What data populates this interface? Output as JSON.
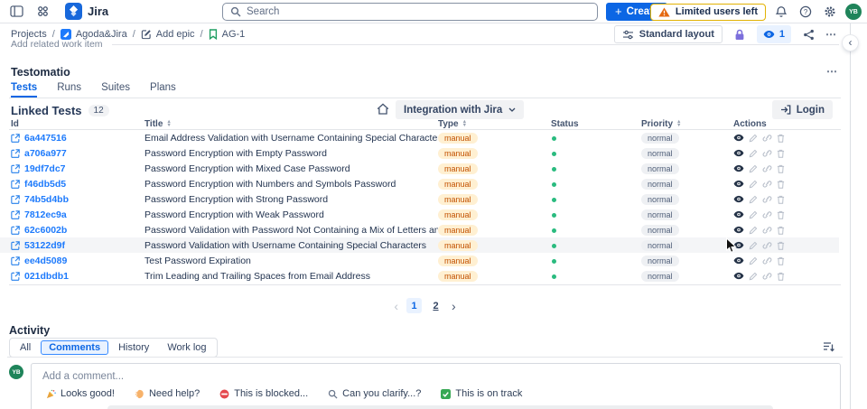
{
  "topbar": {
    "app_name": "Jira",
    "search": {
      "placeholder": "Search"
    },
    "create_button": "Create",
    "warning_badge": "Limited users left",
    "avatar_initials": "YB"
  },
  "breadcrumb": {
    "items": [
      "Projects",
      "Agoda&Jira",
      "Add epic",
      "AG-1"
    ],
    "separator": "/"
  },
  "page_toolbar": {
    "standard_layout_label": "Standard layout",
    "watchers_count": "1",
    "more_label": "⋯"
  },
  "content": {
    "add_related_work_item": "Add related work item",
    "panel_title": "Testomatio",
    "panel_more_label": "⋯",
    "panel_tabs": [
      {
        "label": "Tests",
        "active": true
      },
      {
        "label": "Runs",
        "active": false
      },
      {
        "label": "Suites",
        "active": false
      },
      {
        "label": "Plans",
        "active": false
      }
    ]
  },
  "linked_tests": {
    "title": "Linked Tests",
    "count": "12",
    "integration_dropdown": "Integration with Jira",
    "login_button": "Login",
    "columns": [
      {
        "label": "Id",
        "sortable": false
      },
      {
        "label": "Title",
        "sortable": true
      },
      {
        "label": "Type",
        "sortable": true
      },
      {
        "label": "Status",
        "sortable": false
      },
      {
        "label": "Priority",
        "sortable": true
      },
      {
        "label": "Actions",
        "sortable": false
      }
    ],
    "row_actions": [
      "view-icon",
      "edit-icon",
      "unlink-icon",
      "delete-icon"
    ],
    "rows": [
      {
        "id": "6a447516",
        "title": "Email Address Validation with Username Containing Special Characters",
        "type": "manual",
        "status_dot": "green",
        "priority": "normal",
        "highlighted": false
      },
      {
        "id": "a706a977",
        "title": "Password Encryption with Empty Password",
        "type": "manual",
        "status_dot": "green",
        "priority": "normal",
        "highlighted": false
      },
      {
        "id": "19df7dc7",
        "title": "Password Encryption with Mixed Case Password",
        "type": "manual",
        "status_dot": "green",
        "priority": "normal",
        "highlighted": false
      },
      {
        "id": "f46db5d5",
        "title": "Password Encryption with Numbers and Symbols Password",
        "type": "manual",
        "status_dot": "green",
        "priority": "normal",
        "highlighted": false
      },
      {
        "id": "74b5d4bb",
        "title": "Password Encryption with Strong Password",
        "type": "manual",
        "status_dot": "green",
        "priority": "normal",
        "highlighted": false
      },
      {
        "id": "7812ec9a",
        "title": "Password Encryption with Weak Password",
        "type": "manual",
        "status_dot": "green",
        "priority": "normal",
        "highlighted": false
      },
      {
        "id": "62c6002b",
        "title": "Password Validation with Password Not Containing a Mix of Letters and Numbers",
        "type": "manual",
        "status_dot": "green",
        "priority": "normal",
        "highlighted": false
      },
      {
        "id": "53122d9f",
        "title": "Password Validation with Username Containing Special Characters",
        "type": "manual",
        "status_dot": "green",
        "priority": "normal",
        "highlighted": true
      },
      {
        "id": "ee4d5089",
        "title": "Test Password Expiration",
        "type": "manual",
        "status_dot": "green",
        "priority": "normal",
        "highlighted": false
      },
      {
        "id": "021dbdb1",
        "title": "Trim Leading and Trailing Spaces from Email Address",
        "type": "manual",
        "status_dot": "green",
        "priority": "normal",
        "highlighted": false
      }
    ],
    "pagination": {
      "prev": "‹",
      "pages": [
        "1",
        "2"
      ],
      "current": "1",
      "next": "›"
    }
  },
  "activity": {
    "title": "Activity",
    "filter_tabs": [
      {
        "label": "All",
        "active": false
      },
      {
        "label": "Comments",
        "active": true
      },
      {
        "label": "History",
        "active": false
      },
      {
        "label": "Work log",
        "active": false
      }
    ]
  },
  "comment": {
    "avatar_initials": "YB",
    "placeholder": "Add a comment...",
    "quick_replies": [
      {
        "icon": "party-popper-icon",
        "label": "Looks good!"
      },
      {
        "icon": "waving-hand-icon",
        "label": "Need help?"
      },
      {
        "icon": "no-entry-icon",
        "label": "This is blocked..."
      },
      {
        "icon": "magnifier-small-icon",
        "label": "Can you clarify...?"
      },
      {
        "icon": "check-mark-icon",
        "label": "This is on track"
      }
    ]
  },
  "colors": {
    "brand_blue": "#0c66e4",
    "link_blue": "#1d7afc",
    "type_badge_bg": "#fff0d2",
    "type_badge_text": "#c25100",
    "priority_badge_bg": "#eef0f3",
    "priority_badge_text": "#505f79",
    "status_green": "#2abb7f",
    "lock_purple": "#7c6fdc",
    "warning_orange": "#e56910",
    "avatar_green": "#1f845a"
  }
}
